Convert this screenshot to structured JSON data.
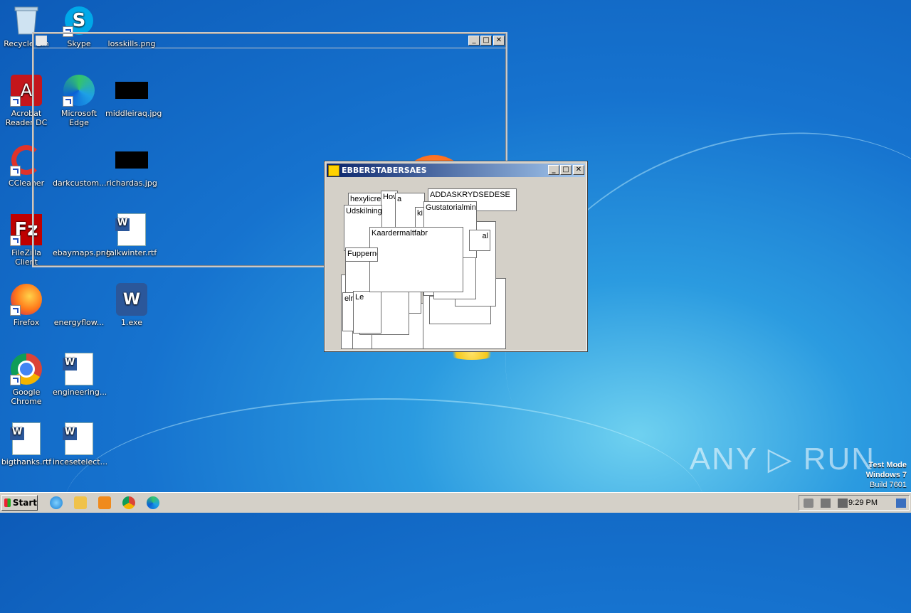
{
  "desktop": {
    "icons": [
      {
        "label": "Recycle Bin"
      },
      {
        "label": "Skype"
      },
      {
        "label": "losskills.png"
      },
      {
        "label": "Acrobat Reader DC"
      },
      {
        "label": "Microsoft Edge"
      },
      {
        "label": "middleiraq.jpg"
      },
      {
        "label": "CCleaner"
      },
      {
        "label": "darkcustom..."
      },
      {
        "label": "richardas.jpg"
      },
      {
        "label": "FileZilla Client"
      },
      {
        "label": "ebaymaps.png"
      },
      {
        "label": "talkwinter.rtf"
      },
      {
        "label": "Firefox"
      },
      {
        "label": "energyflow..."
      },
      {
        "label": "1.exe"
      },
      {
        "label": "Google Chrome"
      },
      {
        "label": "engineering..."
      },
      {
        "label": "bigthanks.rtf"
      },
      {
        "label": "incesetelect..."
      }
    ]
  },
  "window": {
    "title": "EBBERSTABERSAES",
    "boxes": [
      {
        "text": "hexylicre"
      },
      {
        "text": "Hov"
      },
      {
        "text": "a"
      },
      {
        "text": "ADDASKRYDSEDESE"
      },
      {
        "text": "Udskilning"
      },
      {
        "text": "Gustatorialmina"
      },
      {
        "text": "ki"
      },
      {
        "text": "Kaardermaltfabr"
      },
      {
        "text": "al"
      },
      {
        "text": "Fupperne"
      },
      {
        "text": "elr"
      },
      {
        "text": "Le"
      }
    ]
  },
  "taskbar": {
    "start_label": "Start",
    "clock": "9:29 PM"
  },
  "watermark": "ANY ▷ RUN",
  "testmode": {
    "line1": "Test Mode",
    "line2": "Windows 7",
    "line3": "Build 7601"
  }
}
